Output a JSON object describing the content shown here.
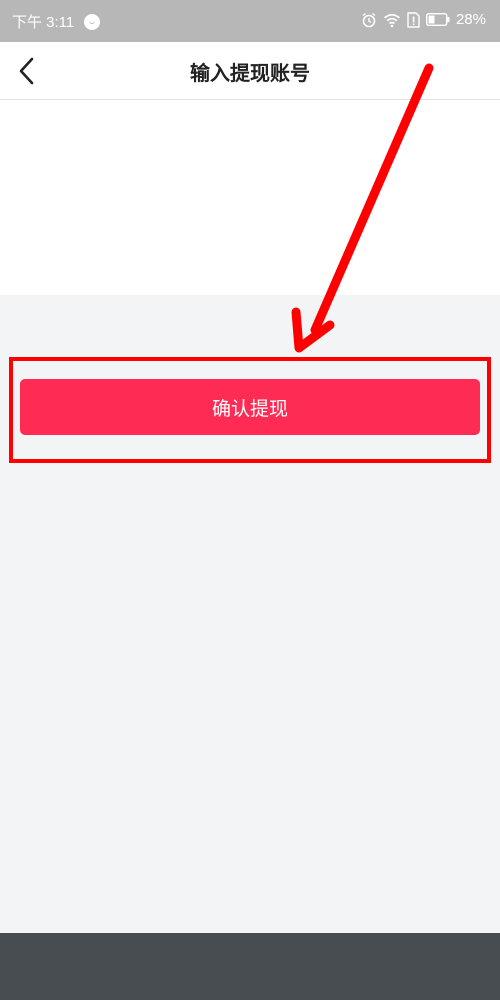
{
  "status_bar": {
    "time": "下午 3:11",
    "battery": "28%",
    "icons": [
      "do-not-disturb-icon",
      "alarm-icon",
      "wifi-icon",
      "sim-alert-icon",
      "battery-icon"
    ]
  },
  "header": {
    "title": "输入提现账号",
    "back_icon": "chevron-left-icon"
  },
  "confirm_button": {
    "label": "确认提现"
  },
  "colors": {
    "accent": "#fe2c55",
    "annotation": "#ff0000",
    "background": "#f3f4f6",
    "status_bar": "#b7b7b7",
    "bottom_bar": "#474d50"
  }
}
